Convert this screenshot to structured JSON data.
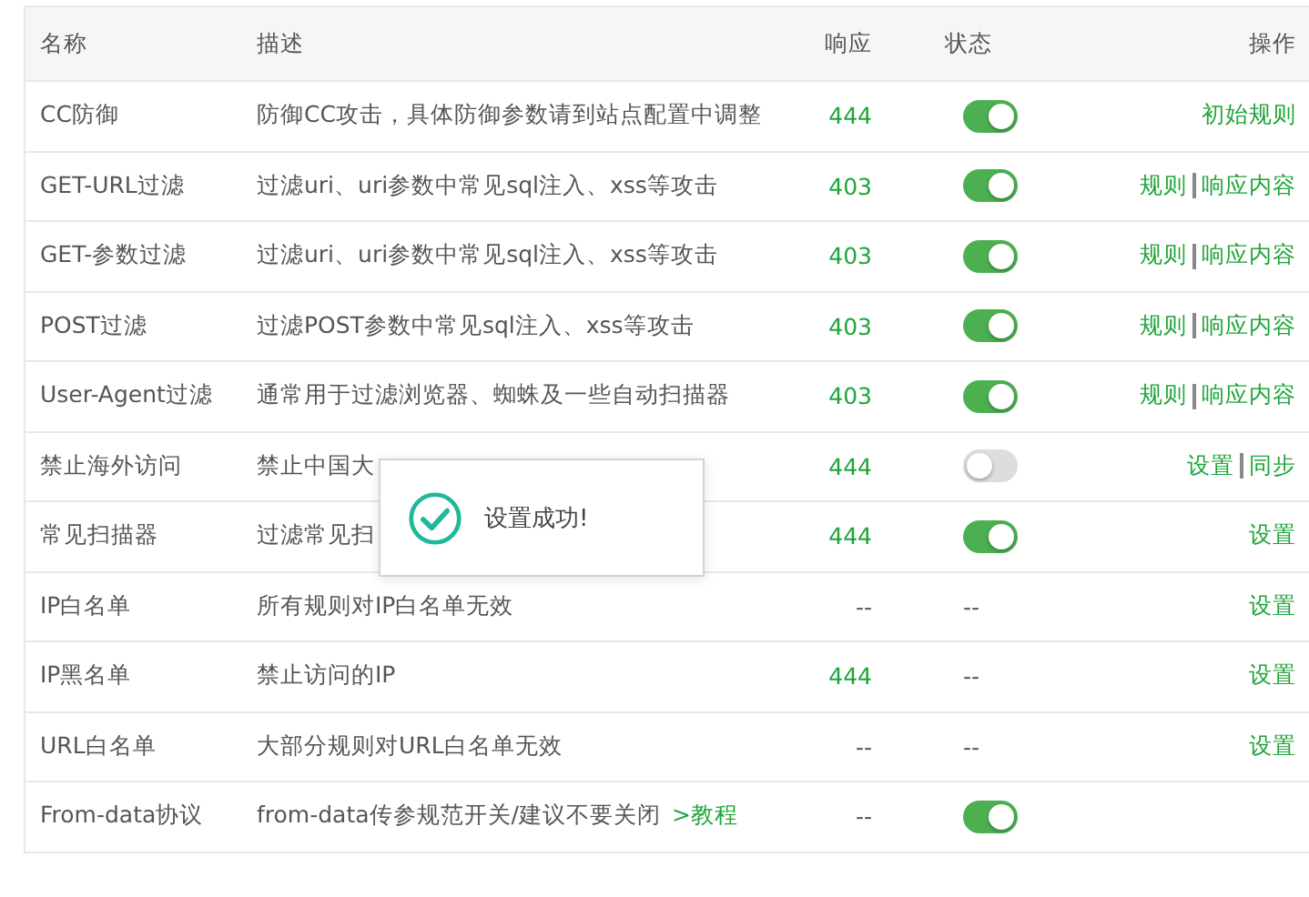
{
  "table": {
    "columns": [
      "名称",
      "描述",
      "响应",
      "状态",
      "操作"
    ],
    "rows": [
      {
        "name": "CC防御",
        "description": "防御CC攻击，具体防御参数请到站点配置中调整",
        "response": "444",
        "status": {
          "kind": "toggle",
          "on": true
        },
        "actions": [
          "初始规则"
        ]
      },
      {
        "name": "GET-URL过滤",
        "description": "过滤uri、uri参数中常见sql注入、xss等攻击",
        "response": "403",
        "status": {
          "kind": "toggle",
          "on": true
        },
        "actions": [
          "规则",
          "响应内容"
        ]
      },
      {
        "name": "GET-参数过滤",
        "description": "过滤uri、uri参数中常见sql注入、xss等攻击",
        "response": "403",
        "status": {
          "kind": "toggle",
          "on": true
        },
        "actions": [
          "规则",
          "响应内容"
        ]
      },
      {
        "name": "POST过滤",
        "description": "过滤POST参数中常见sql注入、xss等攻击",
        "response": "403",
        "status": {
          "kind": "toggle",
          "on": true
        },
        "actions": [
          "规则",
          "响应内容"
        ]
      },
      {
        "name": "User-Agent过滤",
        "description": "通常用于过滤浏览器、蜘蛛及一些自动扫描器",
        "response": "403",
        "status": {
          "kind": "toggle",
          "on": true
        },
        "actions": [
          "规则",
          "响应内容"
        ]
      },
      {
        "name": "禁止海外访问",
        "description": "禁止中国大",
        "response": "444",
        "status": {
          "kind": "toggle",
          "on": false
        },
        "actions": [
          "设置",
          "同步"
        ]
      },
      {
        "name": "常见扫描器",
        "description": "过滤常见扫",
        "response": "444",
        "status": {
          "kind": "toggle",
          "on": true
        },
        "actions": [
          "设置"
        ]
      },
      {
        "name": "IP白名单",
        "description": "所有规则对IP白名单无效",
        "response": "--",
        "status": {
          "kind": "text",
          "text": "--"
        },
        "actions": [
          "设置"
        ]
      },
      {
        "name": "IP黑名单",
        "description": "禁止访问的IP",
        "response": "444",
        "status": {
          "kind": "text",
          "text": "--"
        },
        "actions": [
          "设置"
        ]
      },
      {
        "name": "URL白名单",
        "description": "大部分规则对URL白名单无效",
        "response": "--",
        "status": {
          "kind": "text",
          "text": "--"
        },
        "actions": [
          "设置"
        ]
      },
      {
        "name": "From-data协议",
        "description": "from-data传参规范开关/建议不要关闭",
        "link": ">教程",
        "response": "--",
        "status": {
          "kind": "toggle",
          "on": true
        },
        "actions": []
      }
    ]
  },
  "toast": {
    "message": "设置成功!"
  }
}
